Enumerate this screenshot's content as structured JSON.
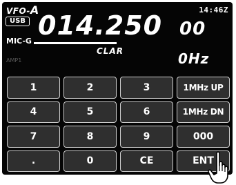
{
  "header": {
    "vfo_prefix": "VFO-",
    "vfo_letter": "A",
    "mode": "USB",
    "mic_gain_label": "MIC-G",
    "clock": "14:46Z"
  },
  "frequency": {
    "main": "014.250",
    "sub": "00"
  },
  "clar": {
    "label": "CLAR",
    "value": "0Hz"
  },
  "amp_label": "AMP1",
  "keypad": {
    "rows": [
      [
        "1",
        "2",
        "3",
        "1MHz UP"
      ],
      [
        "4",
        "5",
        "6",
        "1MHz DN"
      ],
      [
        "7",
        "8",
        "9",
        "000"
      ],
      [
        ".",
        "0",
        "CE",
        "ENT"
      ]
    ]
  },
  "icons": {
    "pointer": "hand-pointer-icon"
  },
  "colors": {
    "panel_bg": "#050505",
    "key_bg": "#2f2f2f",
    "key_border": "#cfcfcf",
    "text": "#ffffff"
  }
}
